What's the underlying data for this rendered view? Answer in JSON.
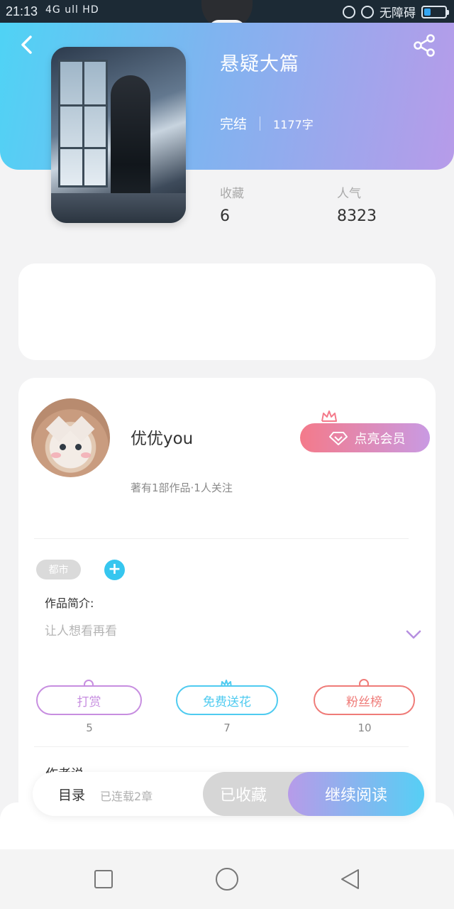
{
  "status_bar": {
    "time": "21:13",
    "network": "4G ull  HD",
    "accessibility": "无障碍",
    "battery_level": 0.3,
    "battery_color": "#34a6f2"
  },
  "header": {
    "back_icon": "chevron-left-icon",
    "share_icon": "share-icon",
    "gradient_start": "#4fd3f5",
    "gradient_end": "#b79be9"
  },
  "book": {
    "title": "悬疑大篇",
    "status": "完结",
    "word_count": "1177字",
    "favorites_label": "收藏",
    "favorites_value": "6",
    "popularity_label": "人气",
    "popularity_value": "8323"
  },
  "author": {
    "name": "优优you",
    "info": "著有1部作品·1人关注",
    "vip_button": "点亮会员"
  },
  "tags": {
    "items": [
      "都市"
    ],
    "add_symbol": "+"
  },
  "intro": {
    "label": "作品简介:",
    "text": "让人想看再看"
  },
  "actions": [
    {
      "label": "打赏",
      "count": "5",
      "color": "#c78ee0",
      "icon": "reward-icon"
    },
    {
      "label": "免费送花",
      "count": "7",
      "color": "#4fcbf0",
      "icon": "flower-icon"
    },
    {
      "label": "粉丝榜",
      "count": "10",
      "color": "#ef7b78",
      "icon": "medal-icon"
    }
  ],
  "author_says": {
    "label": "作者说"
  },
  "bottom_bar": {
    "catalog": "目录",
    "serial_status": "已连载2章",
    "collected": "已收藏",
    "continue_reading": "继续阅读"
  },
  "nav": {
    "recent_icon": "square-icon",
    "home_icon": "circle-icon",
    "back_icon": "triangle-back-icon"
  }
}
